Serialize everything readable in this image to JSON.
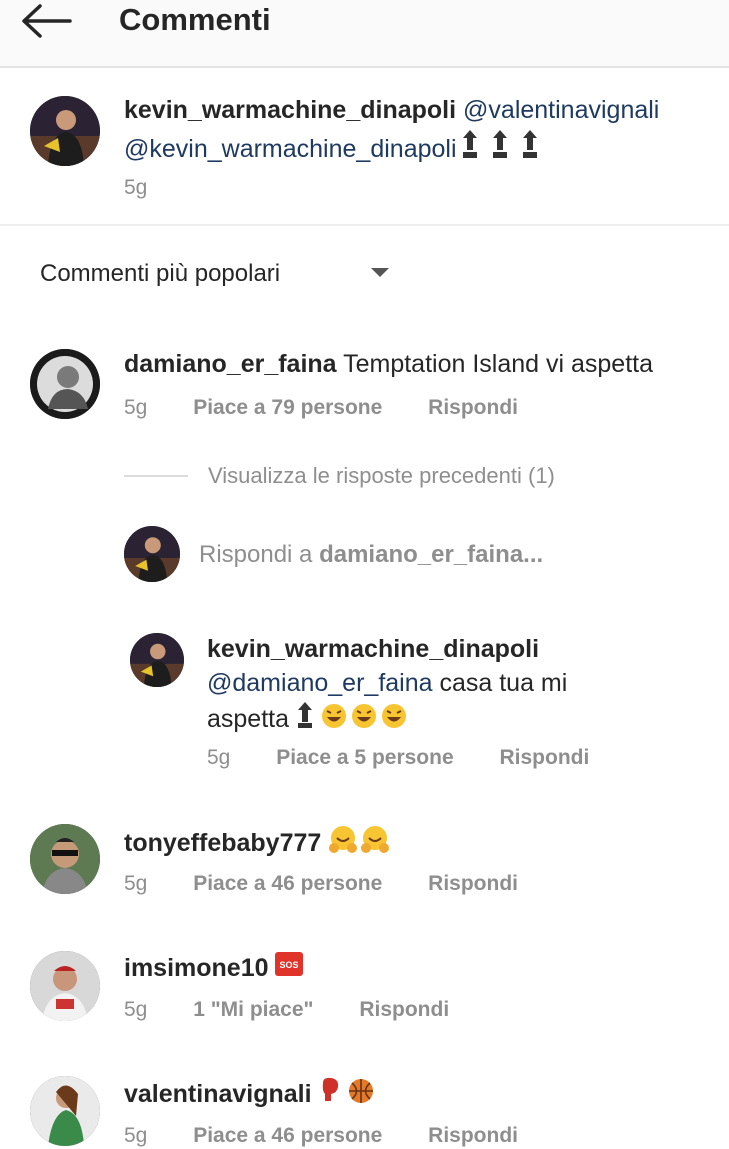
{
  "header": {
    "title": "Commenti"
  },
  "caption": {
    "username": "kevin_warmachine_dinapoli",
    "mention1": "@valentinavignali",
    "mention2": "@kevin_warmachine_dinapoli",
    "time": "5g"
  },
  "sort": {
    "label": "Commenti più popolari"
  },
  "comments": [
    {
      "username": "damiano_er_faina",
      "text": "Temptation Island vi aspetta",
      "time": "5g",
      "likes": "Piace a 79 persone",
      "reply": "Rispondi",
      "view_previous": "Visualizza le risposte precedenti (1)",
      "reply_input_prefix": "Rispondi a ",
      "reply_input_user": "damiano_er_faina...",
      "replies": [
        {
          "username": "kevin_warmachine_dinapoli",
          "mention": "@damiano_er_faina",
          "text1": " casa tua mi",
          "text2": "aspetta",
          "time": "5g",
          "likes": "Piace a 5 persone",
          "reply": "Rispondi"
        }
      ]
    },
    {
      "username": "tonyeffebaby777",
      "time": "5g",
      "likes": "Piace a 46 persone",
      "reply": "Rispondi"
    },
    {
      "username": "imsimone10",
      "sos": "SOS",
      "time": "5g",
      "likes": "1 \"Mi piace\"",
      "reply": "Rispondi"
    },
    {
      "username": "valentinavignali",
      "time": "5g",
      "likes": "Piace a 46 persone",
      "reply": "Rispondi"
    }
  ],
  "colors": {
    "mention": "#1f3a60",
    "muted": "#8e8e8e",
    "text": "#262626",
    "header_bg": "#fafafa"
  }
}
